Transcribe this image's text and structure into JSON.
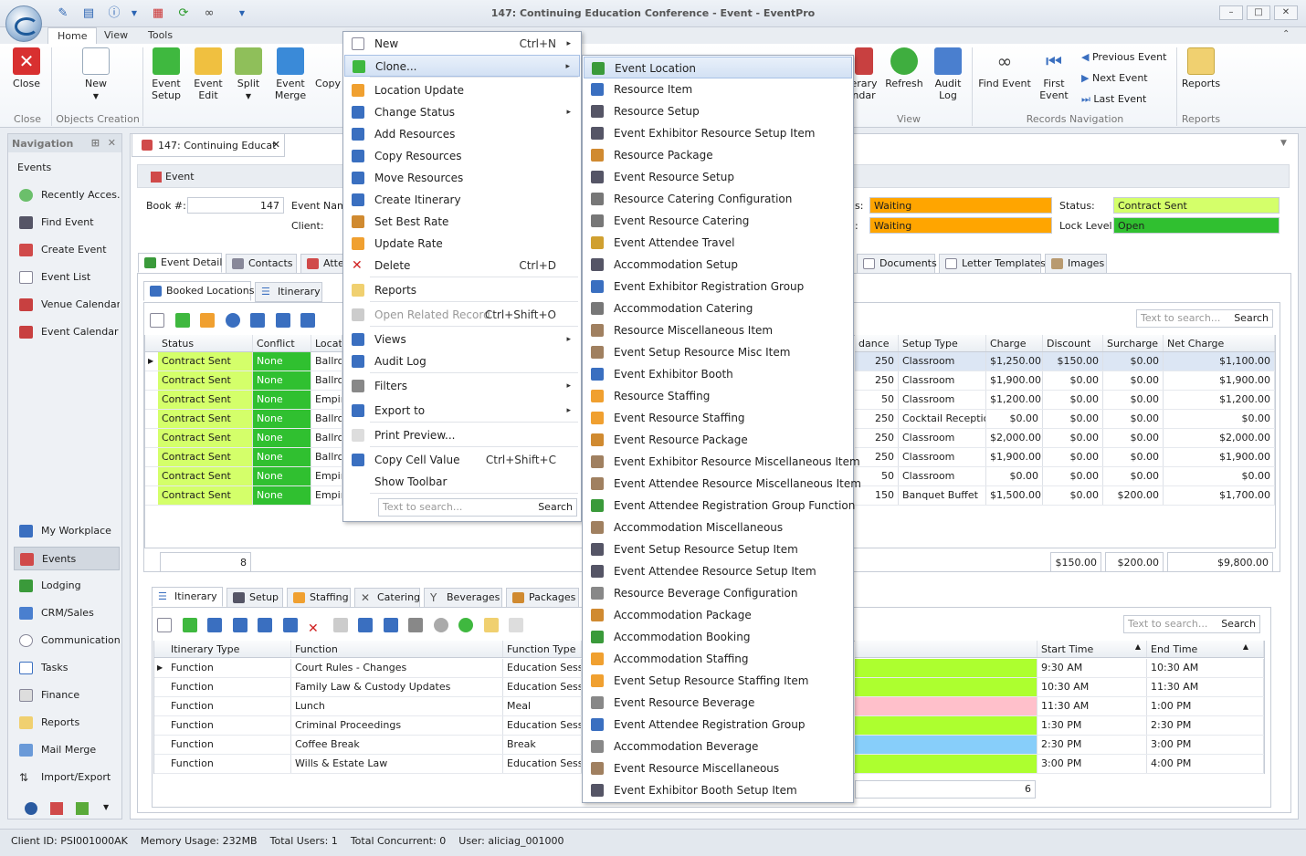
{
  "window": {
    "title": "147: Continuing Education Conference - Event - EventPro"
  },
  "ribbon_tabs": [
    "Home",
    "View",
    "Tools"
  ],
  "ribbon": {
    "close": "Close",
    "new": "New",
    "event_setup": "Event Setup",
    "event_edit": "Event Edit",
    "split": "Split",
    "event_merge": "Event Merge",
    "copy": "Copy",
    "itinerary_calendar": "erary ndar",
    "refresh": "Refresh",
    "audit_log": "Audit Log",
    "find_event": "Find Event",
    "first_event": "First Event",
    "previous_event": "Previous Event",
    "next_event": "Next Event",
    "last_event": "Last Event",
    "reports": "Reports",
    "groups": {
      "close": "Close",
      "objects_creation": "Objects Creation",
      "view": "View",
      "records_navigation": "Records Navigation",
      "reports": "Reports"
    }
  },
  "navigation": {
    "title": "Navigation",
    "top_items": [
      "Events",
      "Recently Acces...",
      "Find Event",
      "Create Event",
      "Event List",
      "Venue Calendar",
      "Event Calendar"
    ],
    "bottom_items": [
      "My Workplace",
      "Events",
      "Lodging",
      "CRM/Sales",
      "Communications",
      "Tasks",
      "Finance",
      "Reports",
      "Mail Merge",
      "Import/Export"
    ]
  },
  "doc": {
    "tab": "147: Continuing Educat",
    "section": "Event",
    "book_label": "Book #:",
    "book_value": "147",
    "event_name_label": "Event Name",
    "client_label": "Client:",
    "status1_label": "s:",
    "status1_value": "Waiting",
    "status2_label": ":",
    "status2_value": "Waiting",
    "status_label": "Status:",
    "status_value": "Contract Sent",
    "lock_label": "Lock Level:",
    "lock_value": "Open",
    "tabs": [
      "Event Detail",
      "Contacts",
      "Atten",
      "Documents",
      "Letter Templates",
      "Images"
    ],
    "sub_tabs": [
      "Booked Locations",
      "Itinerary"
    ],
    "search_placeholder": "Text to search...",
    "search_btn": "Search"
  },
  "booked": {
    "headers": [
      "Status",
      "Conflict",
      "Locati",
      "dance",
      "Setup Type",
      "Charge",
      "Discount",
      "Surcharge",
      "Net Charge"
    ],
    "rows": [
      [
        "Contract Sent",
        "None",
        "Ballroo",
        "250",
        "Classroom",
        "$1,250.00",
        "$150.00",
        "$0.00",
        "$1,100.00"
      ],
      [
        "Contract Sent",
        "None",
        "Ballroo",
        "250",
        "Classroom",
        "$1,900.00",
        "$0.00",
        "$0.00",
        "$1,900.00"
      ],
      [
        "Contract Sent",
        "None",
        "Empire",
        "50",
        "Classroom",
        "$1,200.00",
        "$0.00",
        "$0.00",
        "$1,200.00"
      ],
      [
        "Contract Sent",
        "None",
        "Ballroo",
        "250",
        "Cocktail Reception",
        "$0.00",
        "$0.00",
        "$0.00",
        "$0.00"
      ],
      [
        "Contract Sent",
        "None",
        "Ballroo",
        "250",
        "Classroom",
        "$2,000.00",
        "$0.00",
        "$0.00",
        "$2,000.00"
      ],
      [
        "Contract Sent",
        "None",
        "Ballroo",
        "250",
        "Classroom",
        "$1,900.00",
        "$0.00",
        "$0.00",
        "$1,900.00"
      ],
      [
        "Contract Sent",
        "None",
        "Empire",
        "50",
        "Classroom",
        "$0.00",
        "$0.00",
        "$0.00",
        "$0.00"
      ],
      [
        "Contract Sent",
        "None",
        "Empire",
        "150",
        "Banquet Buffet",
        "$1,500.00",
        "$0.00",
        "$200.00",
        "$1,700.00"
      ]
    ],
    "count": "8",
    "total_discount": "$150.00",
    "total_surcharge": "$200.00",
    "total_net": "$9,800.00"
  },
  "itinerary": {
    "tabs": [
      "Itinerary",
      "Setup",
      "Staffing",
      "Catering",
      "Beverages",
      "Packages"
    ],
    "headers": [
      "Itinerary Type",
      "Function",
      "Function Type",
      "Start Time",
      "End Time"
    ],
    "rows": [
      [
        "Function",
        "Court Rules - Changes",
        "Education Session",
        "9:30 AM",
        "10:30 AM"
      ],
      [
        "Function",
        "Family Law & Custody Updates",
        "Education Session",
        "10:30 AM",
        "11:30 AM"
      ],
      [
        "Function",
        "Lunch",
        "Meal",
        "11:30 AM",
        "1:00 PM"
      ],
      [
        "Function",
        "Criminal Proceedings",
        "Education Session",
        "1:30 PM",
        "2:30 PM"
      ],
      [
        "Function",
        "Coffee Break",
        "Break",
        "2:30 PM",
        "3:00 PM"
      ],
      [
        "Function",
        "Wills & Estate Law",
        "Education Session",
        "3:00 PM",
        "4:00 PM"
      ]
    ],
    "row_colors": [
      "#adff2f",
      "#adff2f",
      "#ffc0cb",
      "#adff2f",
      "#87cefa",
      "#adff2f"
    ],
    "count": "6",
    "search_placeholder": "Text to search...",
    "search_btn": "Search"
  },
  "context_menu": {
    "items": [
      {
        "label": "New",
        "shortcut": "Ctrl+N",
        "arrow": "▸"
      },
      {
        "label": "Clone...",
        "shortcut": "",
        "arrow": "▸"
      },
      {
        "label": "Location Update"
      },
      {
        "label": "Change Status",
        "arrow": "▸"
      },
      {
        "label": "Add Resources"
      },
      {
        "label": "Copy Resources"
      },
      {
        "label": "Move Resources"
      },
      {
        "label": "Create Itinerary"
      },
      {
        "label": "Set Best Rate"
      },
      {
        "label": "Update Rate"
      },
      {
        "label": "Delete",
        "shortcut": "Ctrl+D"
      },
      {
        "label": "Reports"
      },
      {
        "label": "Open Related Record",
        "shortcut": "Ctrl+Shift+O"
      },
      {
        "label": "Views",
        "arrow": "▸"
      },
      {
        "label": "Audit Log"
      },
      {
        "label": "Filters",
        "arrow": "▸"
      },
      {
        "label": "Export to",
        "arrow": "▸"
      },
      {
        "label": "Print Preview..."
      },
      {
        "label": "Copy Cell Value",
        "shortcut": "Ctrl+Shift+C"
      },
      {
        "label": "Show Toolbar"
      }
    ],
    "search_placeholder": "Text to search...",
    "search_btn": "Search"
  },
  "clone_submenu": [
    "Event Location",
    "Resource Item",
    "Resource Setup",
    "Event Exhibitor Resource Setup Item",
    "Resource Package",
    "Event Resource Setup",
    "Resource Catering Configuration",
    "Event Resource Catering",
    "Event Attendee Travel",
    "Accommodation Setup",
    "Event Exhibitor Registration Group",
    "Accommodation Catering",
    "Resource Miscellaneous Item",
    "Event Setup Resource Misc Item",
    "Event Exhibitor Booth",
    "Resource Staffing",
    "Event Resource Staffing",
    "Event Resource Package",
    "Event Exhibitor Resource Miscellaneous Item",
    "Event Attendee Resource Miscellaneous Item",
    "Event Attendee Registration Group Function",
    "Accommodation Miscellaneous",
    "Event Setup Resource Setup Item",
    "Event Attendee Resource Setup Item",
    "Resource Beverage Configuration",
    "Accommodation Package",
    "Accommodation Booking",
    "Accommodation Staffing",
    "Event Setup Resource Staffing Item",
    "Event Resource Beverage",
    "Event Attendee Registration Group",
    "Accommodation Beverage",
    "Event Resource Miscellaneous",
    "Event Exhibitor Booth Setup Item"
  ],
  "statusbar": {
    "client_id": "Client ID: PSI001000AK",
    "memory": "Memory Usage: 232MB",
    "users": "Total Users: 1",
    "concurrent": "Total Concurrent: 0",
    "user": "User: aliciag_001000"
  }
}
